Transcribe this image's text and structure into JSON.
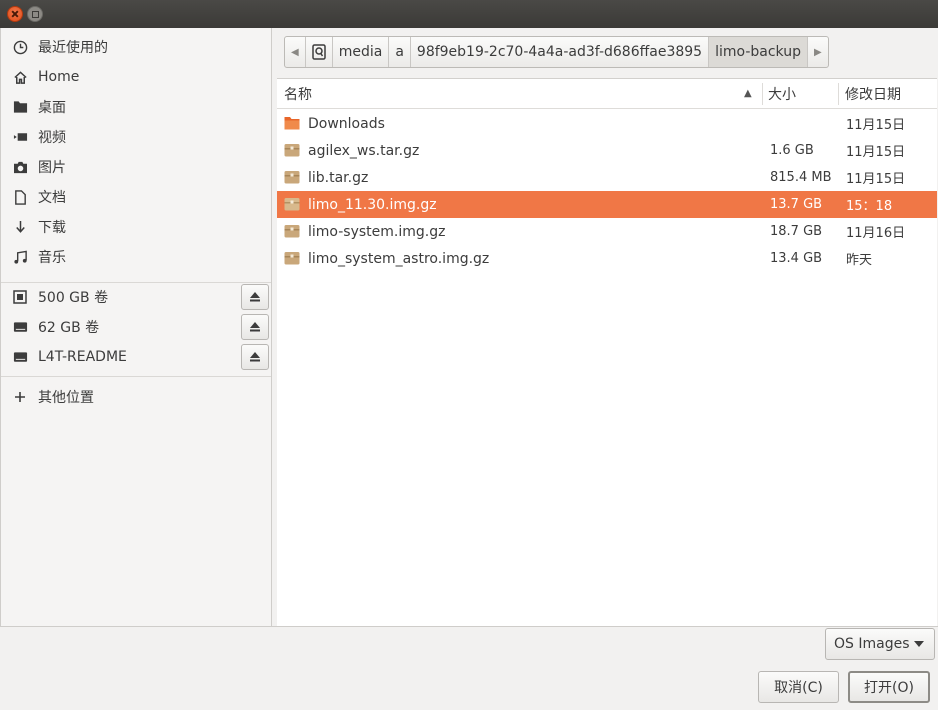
{
  "sidebar": {
    "places": [
      {
        "label": "最近使用的",
        "icon": "clock-icon"
      },
      {
        "label": "Home",
        "icon": "home-icon"
      },
      {
        "label": "桌面",
        "icon": "folder-icon"
      },
      {
        "label": "视频",
        "icon": "video-icon"
      },
      {
        "label": "图片",
        "icon": "camera-icon"
      },
      {
        "label": "文档",
        "icon": "document-icon"
      },
      {
        "label": "下载",
        "icon": "download-icon"
      },
      {
        "label": "音乐",
        "icon": "music-icon"
      }
    ],
    "devices": [
      {
        "label": "500 GB 卷",
        "icon": "chip-drive-icon"
      },
      {
        "label": "62 GB 卷",
        "icon": "drive-icon"
      },
      {
        "label": "L4T-README",
        "icon": "drive-icon"
      }
    ],
    "other": {
      "label": "其他位置",
      "icon": "plus-icon"
    }
  },
  "pathbar": {
    "segments": [
      "media",
      "a",
      "98f9eb19-2c70-4a4a-ad3f-d686ffae3895",
      "limo-backup"
    ],
    "active": "limo-backup"
  },
  "columns": {
    "name": "名称",
    "size": "大小",
    "modified": "修改日期"
  },
  "files": [
    {
      "name": "Downloads",
      "size": "",
      "modified": "11月15日",
      "type": "folder"
    },
    {
      "name": "agilex_ws.tar.gz",
      "size": "1.6 GB",
      "modified": "11月15日",
      "type": "archive"
    },
    {
      "name": "lib.tar.gz",
      "size": "815.4 MB",
      "modified": "11月15日",
      "type": "archive"
    },
    {
      "name": "limo_11.30.img.gz",
      "size": "13.7 GB",
      "modified": "15：18",
      "type": "archive",
      "selected": true
    },
    {
      "name": "limo-system.img.gz",
      "size": "18.7 GB",
      "modified": "11月16日",
      "type": "archive"
    },
    {
      "name": "limo_system_astro.img.gz",
      "size": "13.4 GB",
      "modified": "昨天",
      "type": "archive"
    }
  ],
  "filter": {
    "value": "OS Images"
  },
  "buttons": {
    "cancel": "取消(C)",
    "open": "打开(O)"
  },
  "colors": {
    "selection": "#f07746",
    "close_button": "#e95420",
    "folder": "#e8662a",
    "archive": "#c9a77a"
  }
}
